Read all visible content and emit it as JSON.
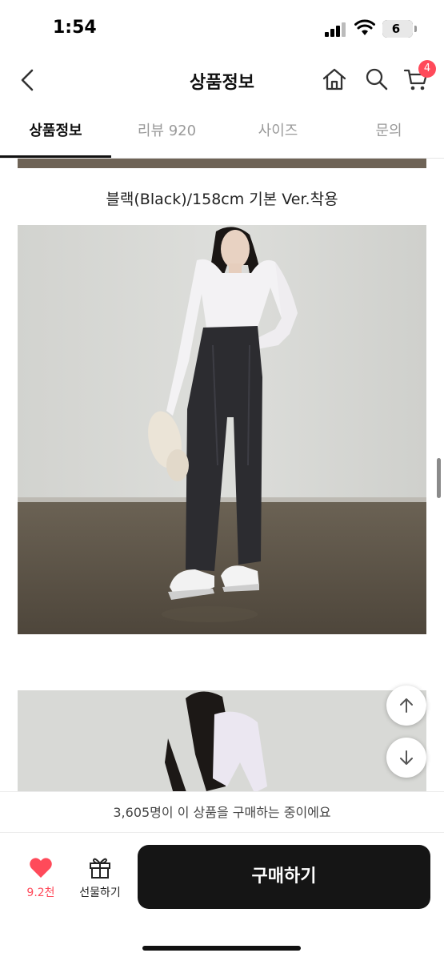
{
  "status_bar": {
    "time": "1:54",
    "battery": "6"
  },
  "header": {
    "title": "상품정보",
    "cart_count": "4"
  },
  "tabs": [
    {
      "label": "상품정보",
      "active": true
    },
    {
      "label": "리뷰 920",
      "active": false
    },
    {
      "label": "사이즈",
      "active": false
    },
    {
      "label": "문의",
      "active": false
    }
  ],
  "content": {
    "caption": "블랙(Black)/158cm 기본 Ver.착용"
  },
  "purchase_banner": "3,605명이 이 상품을 구매하는 중이에요",
  "bottom_bar": {
    "like_count": "9.2천",
    "gift_label": "선물하기",
    "buy_label": "구매하기"
  },
  "colors": {
    "accent": "#ff4a5a",
    "buy_button": "#151515"
  },
  "icons": [
    "back-icon",
    "home-icon",
    "search-icon",
    "cart-icon",
    "arrow-up-icon",
    "arrow-down-icon",
    "heart-icon",
    "gift-icon"
  ]
}
